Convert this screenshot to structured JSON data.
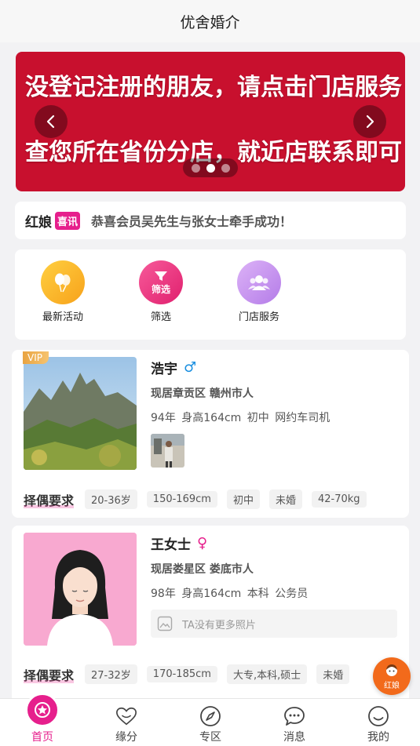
{
  "header": {
    "title": "优舍婚介"
  },
  "banner": {
    "line1": "没登记注册的朋友，请点击门店服务",
    "line2": "查您所在省份分店，就近店联系即可",
    "page_count": 3,
    "active_page": 2
  },
  "notice": {
    "brand": "红娘",
    "tag": "喜讯",
    "message": "恭喜会员吴先生与张女士牵手成功！"
  },
  "quick_actions": [
    {
      "label": "最新活动",
      "icon": "balloon-icon",
      "color": "#f9b233"
    },
    {
      "label": "筛选",
      "icon_text": "筛选",
      "icon": "filter-icon",
      "color": "#e8337e"
    },
    {
      "label": "门店服务",
      "icon": "group-icon",
      "color": "#c78ff0"
    }
  ],
  "profiles": [
    {
      "vip_badge": "VIP",
      "name": "浩宇",
      "gender_symbol": "♂",
      "gender_color": "#1a8fe0",
      "location": "现居章贡区  赣州市人",
      "info": "94年  身高164cm  初中  网约车司机",
      "requirement_label": "择偶要求",
      "requirements": [
        "20-36岁",
        "150-169cm",
        "初中",
        "未婚",
        "42-70kg"
      ]
    },
    {
      "name": "王女士",
      "gender_symbol": "♀",
      "gender_color": "#e61f8c",
      "location": "现居娄星区  娄底市人",
      "info": "98年  身高164cm  本科  公务员",
      "no_photo_text": "TA没有更多照片",
      "requirement_label": "择偶要求",
      "requirements": [
        "27-32岁",
        "170-185cm",
        "大专,本科,硕士",
        "未婚"
      ]
    }
  ],
  "fab": {
    "label": "红娘"
  },
  "tabbar": {
    "tabs": [
      {
        "label": "首页",
        "icon": "home-icon",
        "active": true
      },
      {
        "label": "缘分",
        "icon": "heart-icon",
        "active": false
      },
      {
        "label": "专区",
        "icon": "compass-icon",
        "active": false
      },
      {
        "label": "消息",
        "icon": "chat-icon",
        "active": false
      },
      {
        "label": "我的",
        "icon": "smile-icon",
        "active": false
      }
    ]
  },
  "colors": {
    "brand_pink": "#e61f8c",
    "banner_red": "#c8102e",
    "fab_orange": "#f26a1b"
  }
}
